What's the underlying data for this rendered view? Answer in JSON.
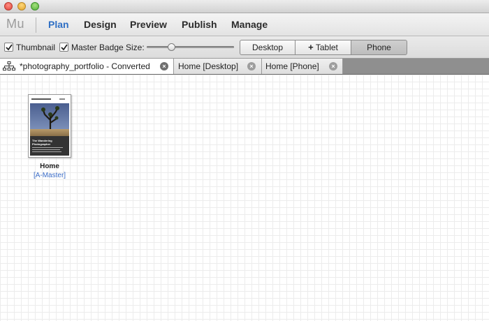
{
  "app": {
    "logo": "Mu"
  },
  "nav": {
    "items": [
      {
        "label": "Plan",
        "active": true
      },
      {
        "label": "Design"
      },
      {
        "label": "Preview"
      },
      {
        "label": "Publish"
      },
      {
        "label": "Manage"
      }
    ]
  },
  "toolbar": {
    "thumbnail_label": "Thumbnail",
    "thumbnail_checked": true,
    "master_badge_label": "Master Badge",
    "master_badge_checked": true,
    "size_label": "Size:",
    "size_value": 0.28,
    "layouts": [
      {
        "label": "Desktop",
        "icon": ""
      },
      {
        "label": "Tablet",
        "icon": "plus-icon"
      },
      {
        "label": "Phone",
        "selected": true
      }
    ]
  },
  "tabs": [
    {
      "label": "*photography_portfolio - Converted",
      "active": true,
      "icon": "sitemap-icon"
    },
    {
      "label": "Home [Desktop]"
    },
    {
      "label": "Home [Phone]"
    }
  ],
  "pages": [
    {
      "name": "Home",
      "master": "[A-Master]",
      "thumbnail": {
        "caption_line1": "The Wandering",
        "caption_line2": "Photographer"
      }
    }
  ],
  "colors": {
    "active_nav": "#2f6fc4",
    "master_link": "#3a6cc7"
  }
}
